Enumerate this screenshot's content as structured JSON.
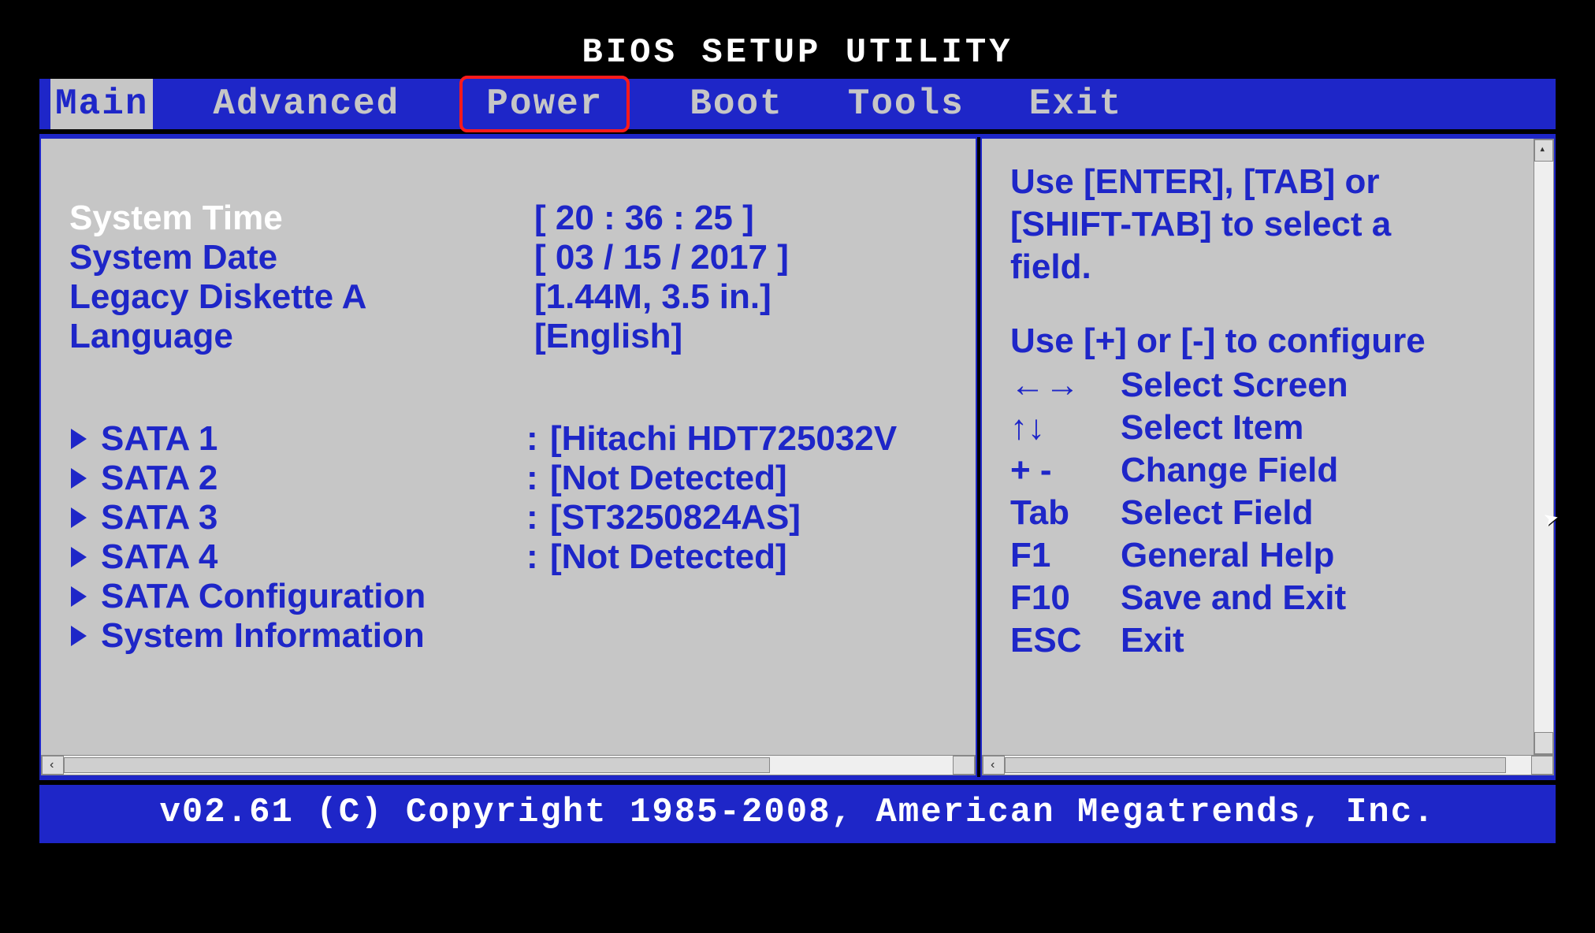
{
  "title": "BIOS SETUP UTILITY",
  "tabs": {
    "main": "Main",
    "advanced": "Advanced",
    "power": "Power",
    "boot": "Boot",
    "tools": "Tools",
    "exit": "Exit"
  },
  "main": {
    "system_time_label": "System Time",
    "system_time_value": "[ 20 : 36 : 25 ]",
    "system_date_label": "System Date",
    "system_date_value": "[ 03 / 15 / 2017 ]",
    "legacy_diskette_label": "Legacy Diskette A",
    "legacy_diskette_value": "[1.44M, 3.5 in.]",
    "language_label": "Language",
    "language_value": "[English]",
    "sata1_label": "SATA 1",
    "sata1_value": "[Hitachi HDT725032V",
    "sata2_label": "SATA 2",
    "sata2_value": "[Not Detected]",
    "sata3_label": "SATA 3",
    "sata3_value": "[ST3250824AS]",
    "sata4_label": "SATA 4",
    "sata4_value": "[Not Detected]",
    "sata_config_label": "SATA Configuration",
    "system_info_label": "System Information"
  },
  "help": {
    "line1": "Use [ENTER], [TAB] or",
    "line2": "[SHIFT-TAB] to select a",
    "line3": "field.",
    "line4": "Use [+] or [-] to configure",
    "keys": {
      "screen_key": "←→",
      "screen_desc": "Select Screen",
      "item_key": "↑↓",
      "item_desc": "Select Item",
      "field_key": "+ -",
      "field_desc": "Change Field",
      "tab_key": "Tab",
      "tab_desc": "Select Field",
      "f1_key": "F1",
      "f1_desc": "General Help",
      "f10_key": "F10",
      "f10_desc": "Save and Exit",
      "esc_key": "ESC",
      "esc_desc": "Exit"
    }
  },
  "footer": "v02.61 (C) Copyright 1985-2008, American Megatrends, Inc."
}
